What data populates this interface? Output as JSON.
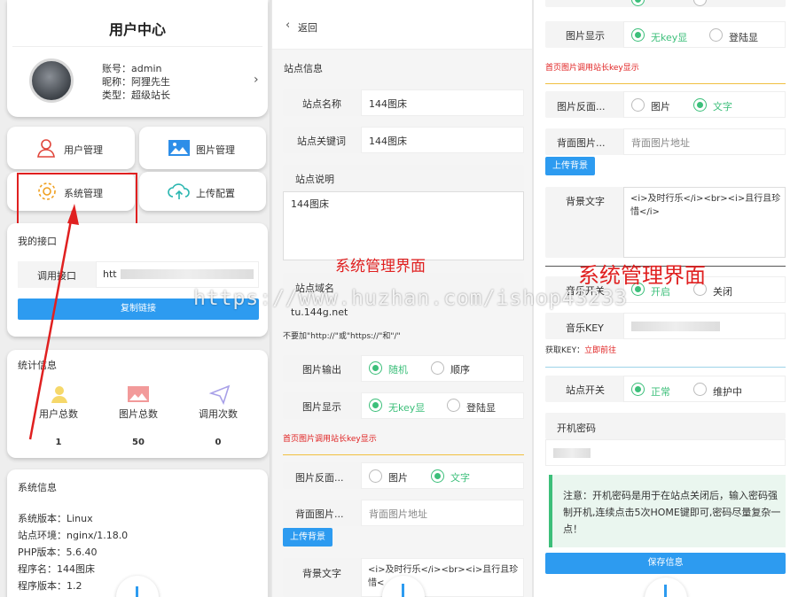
{
  "p1": {
    "title": "用户中心",
    "account_label": "账号：admin",
    "nickname_label": "昵称：阿狸先生",
    "type_label": "类型：超级站长",
    "menu": [
      {
        "label": "用户管理",
        "icon": "user-icon"
      },
      {
        "label": "图片管理",
        "icon": "image-icon"
      },
      {
        "label": "系统管理",
        "icon": "gear-icon"
      },
      {
        "label": "上传配置",
        "icon": "cloud-upload-icon"
      }
    ],
    "api_title": "我的接口",
    "api_label": "调用接口",
    "api_value": "htt",
    "copy_button": "复制链接",
    "stats_title": "统计信息",
    "stats": [
      {
        "label": "用户总数",
        "value": "1",
        "icon": "users-icon"
      },
      {
        "label": "图片总数",
        "value": "50",
        "icon": "picture-icon"
      },
      {
        "label": "调用次数",
        "value": "0",
        "icon": "send-icon"
      }
    ],
    "sys_title": "系统信息",
    "sys_lines": [
      "系统版本：Linux",
      "站点环境：nginx/1.18.0",
      "PHP版本：5.6.40",
      "程序名：144图床",
      "程序版本：1.2"
    ]
  },
  "p2": {
    "back": "返回",
    "site_info": "站点信息",
    "site_name_label": "站点名称",
    "site_name_value": "144图床",
    "site_kw_label": "站点关键词",
    "site_kw_value": "144图床",
    "site_desc_label": "站点说明",
    "site_desc_value": "144图床",
    "site_domain_label": "站点域名",
    "site_domain_value": "tu.144g.net",
    "domain_hint": "不要加\"http://\"或\"https://\"和\"/\"",
    "output_label": "图片输出",
    "output_opt1": "随机",
    "output_opt2": "顺序",
    "display_label": "图片显示",
    "display_opt1": "无key显",
    "display_opt2": "登陆显",
    "display_hint": "首页图片调用站长key显示",
    "back_label": "图片反面...",
    "back_opt1": "图片",
    "back_opt2": "文字",
    "bgimg_label": "背面图片...",
    "bgimg_placeholder": "背面图片地址",
    "upload_bg": "上传背景",
    "bgtext_label": "背景文字",
    "bgtext_value": "<i>及时行乐</i><br><i>且行且珍惜<"
  },
  "p3": {
    "display_label": "图片显示",
    "display_opt1": "无key显",
    "display_opt2": "登陆显",
    "display_hint": "首页图片调用站长key显示",
    "back_label": "图片反面...",
    "back_opt1": "图片",
    "back_opt2": "文字",
    "bgimg_label": "背面图片...",
    "bgimg_placeholder": "背面图片地址",
    "upload_bg": "上传背景",
    "bgtext_label": "背景文字",
    "bgtext_value": "<i>及时行乐</i><br><i>且行且珍惜</i>",
    "music_label": "音乐开关",
    "music_opt1": "开启",
    "music_opt2": "关闭",
    "musickey_label": "音乐KEY",
    "getkey_prefix": "获取KEY：",
    "getkey_link": "立即前往",
    "site_switch_label": "站点开关",
    "site_opt1": "正常",
    "site_opt2": "维护中",
    "pwd_label": "开机密码",
    "notice": "注意：开机密码是用于在站点关闭后，输入密码强制开机,连续点击5次HOME键即可,密码尽量复杂一点！",
    "save_button": "保存信息"
  },
  "overlay": {
    "caption_small": "系统管理界面",
    "caption_large": "系统管理界面",
    "watermark": "https://www.huzhan.com/ishop43233"
  }
}
